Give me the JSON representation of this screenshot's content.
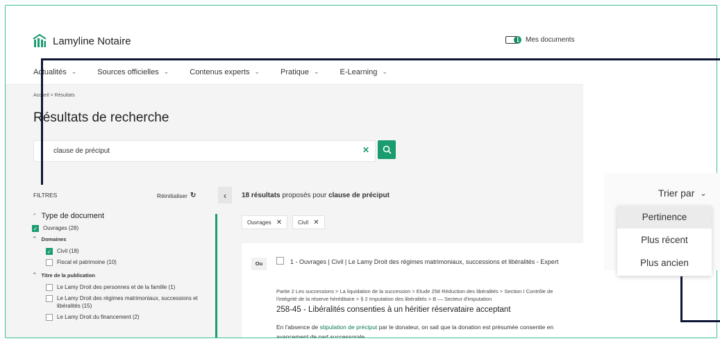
{
  "app": {
    "name": "Lamyline Notaire",
    "my_documents": "Mes documents",
    "doc_count": "1"
  },
  "nav": [
    {
      "label": "Actualités"
    },
    {
      "label": "Sources officielles"
    },
    {
      "label": "Contenus experts"
    },
    {
      "label": "Pratique"
    },
    {
      "label": "E-Learning"
    }
  ],
  "breadcrumb": "Accueil > Résultats",
  "page_title": "Résultats de recherche",
  "search": {
    "value": "clause de préciput"
  },
  "filters": {
    "title": "FILTRES",
    "reset": "Réinitialiser",
    "doc_type_heading": "Type de document",
    "ouvrages": "Ouvrages (28)",
    "domaines_heading": "Domaines",
    "civil": "Civil (18)",
    "fiscal": "Fiscal et patrimoine (10)",
    "titre_heading": "Titre de la publication",
    "pub1": "Le Lamy Droit des personnes et de la famille (1)",
    "pub2": "Le Lamy Droit des régimes matrimoniaux, successions et libéralités (15)",
    "pub3": "Le Lamy Droit du financement (2)"
  },
  "results": {
    "count_text": "18 résultats",
    "proposed_text": " proposés pour ",
    "query": "clause de préciput",
    "chips": [
      "Ouvrages",
      "Civil"
    ],
    "item": {
      "badge": "Ou",
      "title": "1 - Ouvrages | Civil | Le Lamy Droit des régimes matrimoniaux, successions et libéralités - Expert",
      "path": "Partie 2 Les successions > La liquidation de la succession > Etude 258 Réduction des libéralités > Section I Contrôle de l'intégrité de la réserve héréditaire > § 2 Imputation des libéralités > B — Secteur d'imputation",
      "heading": "258-45 - Libéralités consenties à un héritier réservataire acceptant",
      "excerpt_before": "En l'absence de ",
      "excerpt_highlight": "stipulation de préciput",
      "excerpt_after": " par le donateur, on sait que la donation est présumée consentie en avancement de part successorale."
    }
  },
  "sort": {
    "label": "Trier par",
    "options": [
      "Pertinence",
      "Plus récent",
      "Plus ancien"
    ],
    "selected": "Pertinence"
  },
  "colors": {
    "accent": "#1a9c6e",
    "frame": "#3fbf94",
    "overlay": "#0d1436"
  }
}
